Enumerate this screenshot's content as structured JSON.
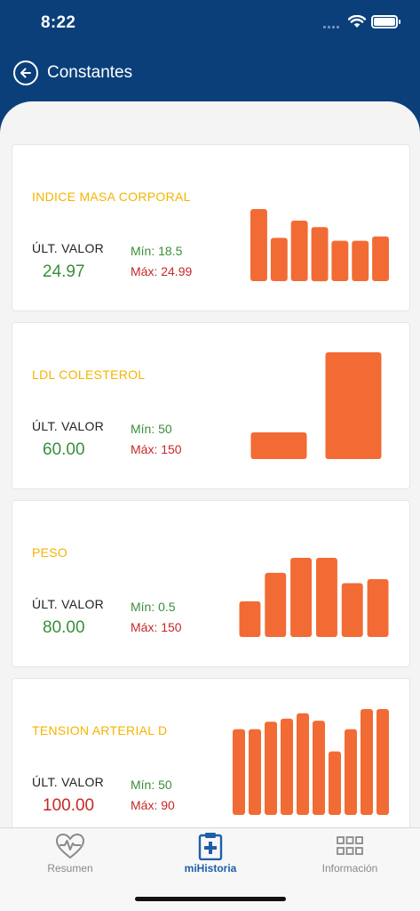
{
  "status_bar": {
    "time": "8:22"
  },
  "navbar": {
    "title": "Constantes"
  },
  "colors": {
    "header": "#0a3f7a",
    "bar": "#f26b35",
    "title": "#f5b400",
    "min": "#3a8e3a",
    "max": "#c62828",
    "tab_active": "#1f5fa8"
  },
  "cards": [
    {
      "title": "INDICE MASA CORPORAL",
      "last_label": "ÚLT. VALOR",
      "last_value": "24.97",
      "last_value_status": "normal",
      "min": "Mín: 18.5",
      "max": "Máx: 24.99",
      "chart_data": {
        "type": "bar",
        "values": [
          1.0,
          0.6,
          0.84,
          0.75,
          0.56,
          0.56,
          0.62
        ]
      }
    },
    {
      "title": "LDL COLESTEROL",
      "last_label": "ÚLT. VALOR",
      "last_value": "60.00",
      "last_value_status": "normal",
      "min": "Mín: 50",
      "max": "Máx: 150",
      "chart_data": {
        "type": "bar",
        "values": [
          0.25,
          1.0
        ]
      }
    },
    {
      "title": "PESO",
      "last_label": "ÚLT. VALOR",
      "last_value": "80.00",
      "last_value_status": "normal",
      "min": "Mín: 0.5",
      "max": "Máx: 150",
      "chart_data": {
        "type": "bar",
        "values": [
          0.45,
          0.81,
          1.0,
          1.0,
          0.68,
          0.73
        ]
      }
    },
    {
      "title": "TENSION ARTERIAL D",
      "last_label": "ÚLT. VALOR",
      "last_value": "100.00",
      "last_value_status": "high",
      "min": "Mín: 50",
      "max": "Máx: 90",
      "chart_data": {
        "type": "bar",
        "values": [
          0.81,
          0.81,
          0.88,
          0.91,
          0.96,
          0.89,
          0.6,
          0.81,
          1.0,
          1.0
        ]
      }
    }
  ],
  "tabbar": {
    "tabs": [
      {
        "label": "Resumen",
        "icon": "heart-pulse-icon",
        "active": false
      },
      {
        "label": "miHistoria",
        "icon": "clipboard-plus-icon",
        "active": true
      },
      {
        "label": "Información",
        "icon": "grid-icon",
        "active": false
      }
    ]
  }
}
